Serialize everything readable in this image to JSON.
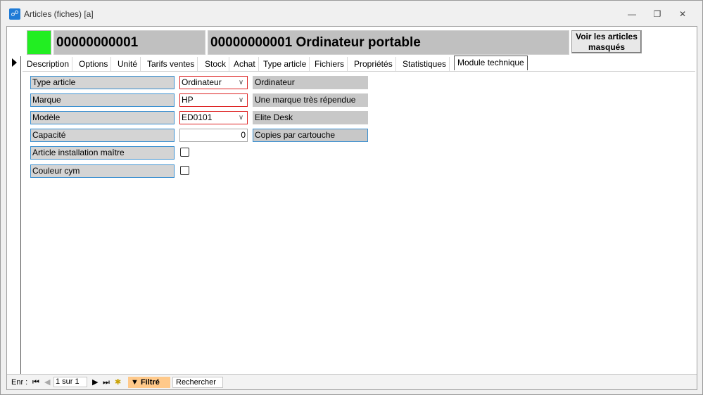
{
  "window": {
    "title": "Articles (fiches) [a]",
    "minimize_icon": "minimize-icon",
    "maximize_icon": "restore-icon",
    "close_icon": "close-icon"
  },
  "header": {
    "status_color": "#22ee22",
    "code": "00000000001",
    "full_title": "00000000001 Ordinateur portable",
    "show_hidden_button": "Voir les articles masqués"
  },
  "tabs": [
    "Description",
    "Options",
    "Unité",
    "Tarifs ventes",
    "Stock",
    "Achat",
    "Type article",
    "Fichiers",
    "Propriétés",
    "Statistiques",
    "Module technique"
  ],
  "active_tab": "Module technique",
  "fields": {
    "type_article": {
      "label": "Type article",
      "value": "Ordinateur",
      "info": "Ordinateur"
    },
    "marque": {
      "label": "Marque",
      "value": "HP",
      "info": "Une marque très répendue"
    },
    "modele": {
      "label": "Modèle",
      "value": "ED0101",
      "info": "Elite Desk"
    },
    "capacite": {
      "label": "Capacité",
      "value": "0",
      "info": "Copies par cartouche"
    },
    "article_installation_maitre": {
      "label": "Article installation maître",
      "checked": false
    },
    "couleur_cym": {
      "label": "Couleur cym",
      "checked": false
    }
  },
  "statusbar": {
    "record_label": "Enr :",
    "record_position": "1 sur 1",
    "filter_label": "Filtré",
    "search_label": "Rechercher"
  }
}
